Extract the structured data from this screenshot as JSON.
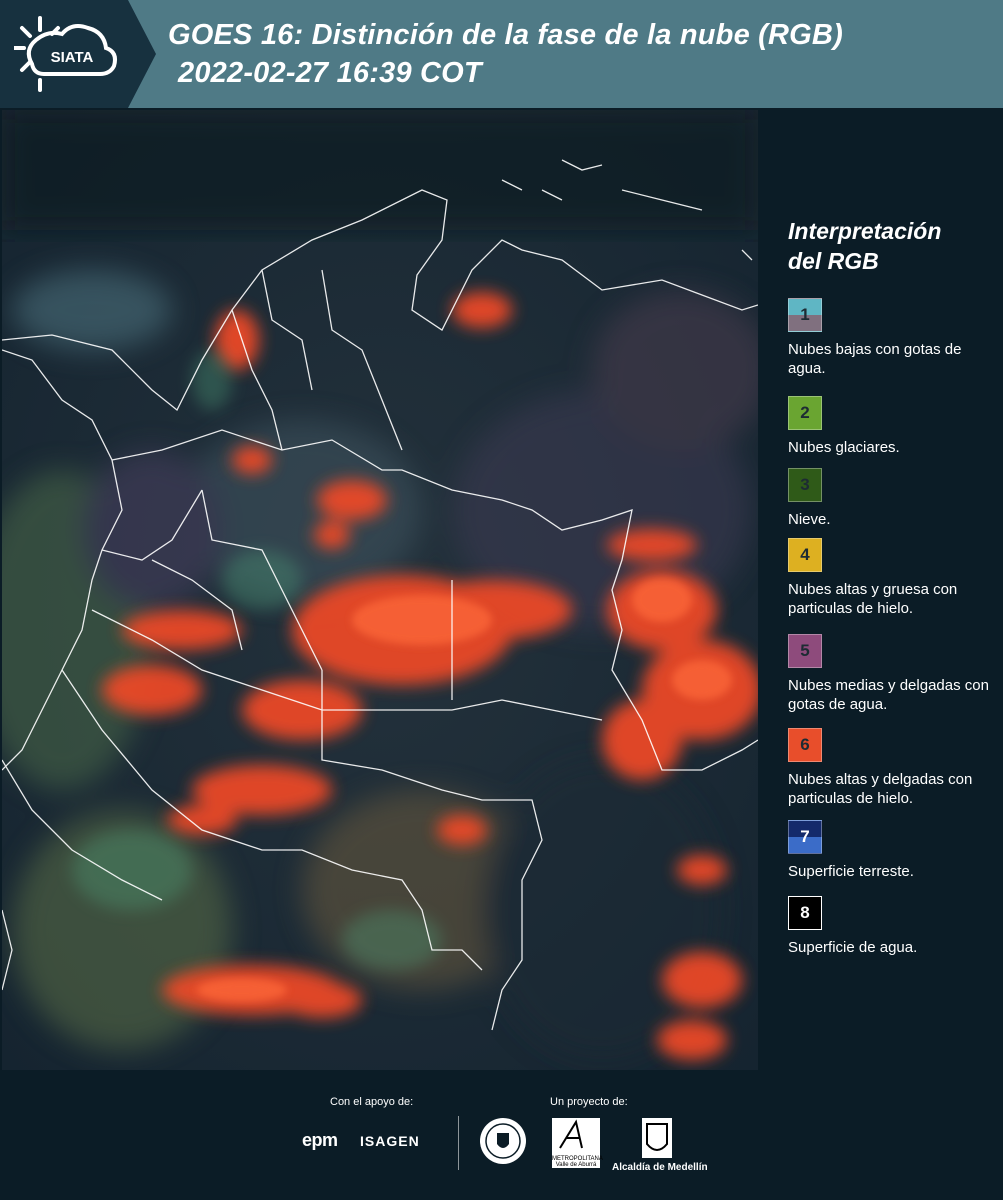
{
  "header": {
    "logo_text": "SIATA",
    "title_line1": "GOES 16: Distinción de la fase de la nube (RGB)",
    "title_line2": "2022-02-27 16:39 COT"
  },
  "legend": {
    "title_line1": "Interpretación",
    "title_line2": "del RGB",
    "items": [
      {
        "number": "1",
        "description": "Nubes bajas con gotas de agua.",
        "color_top": "#5fb6c4",
        "color_bottom": "#80707f"
      },
      {
        "number": "2",
        "description": "Nubes glaciares.",
        "color_top": "#6aa531",
        "color_bottom": "#6aa531"
      },
      {
        "number": "3",
        "description": "Nieve.",
        "color_top": "#2f5a18",
        "color_bottom": "#2f5a18"
      },
      {
        "number": "4",
        "description": "Nubes altas y gruesa con particulas de hielo.",
        "color_top": "#ddb021",
        "color_bottom": "#ddb021"
      },
      {
        "number": "5",
        "description": "Nubes medias y delgadas con gotas de agua.",
        "color_top": "#8e4b7c",
        "color_bottom": "#8e4b7c"
      },
      {
        "number": "6",
        "description": "Nubes altas y delgadas con particulas de hielo.",
        "color_top": "#e84e2b",
        "color_bottom": "#e84e2b"
      },
      {
        "number": "7",
        "description": "Superficie terreste.",
        "color_top": "#142a6b",
        "color_bottom": "#3b6cc8"
      },
      {
        "number": "8",
        "description": "Superficie de agua.",
        "color_top": "#000000",
        "color_bottom": "#000000"
      }
    ]
  },
  "footer": {
    "support_label": "Con el apoyo de:",
    "project_label": "Un proyecto de:",
    "epm": "epm",
    "isagen": "ISAGEN",
    "area_metropolitana": "METROPOLITANA Valle de Aburrá",
    "alcaldia": "Alcaldía de Medellín"
  }
}
